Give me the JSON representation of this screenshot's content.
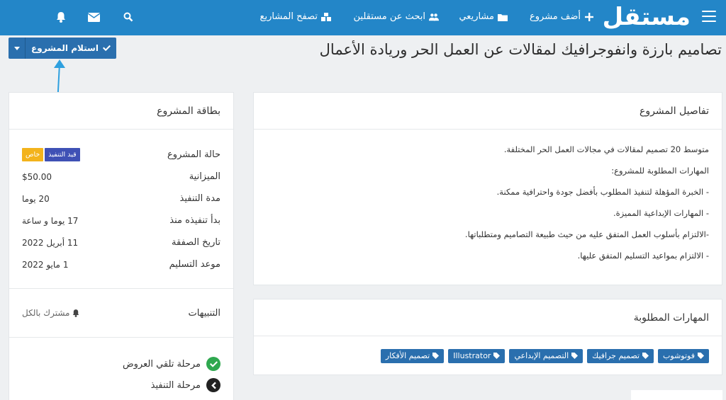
{
  "header": {
    "logo": "مستقل",
    "nav": {
      "add_project": "أضف مشروع",
      "my_projects": "مشاريعي",
      "find_freelancers": "ابحث عن مستقلين",
      "browse_projects": "تصفح المشاريع"
    },
    "icons": [
      "hamburger-icon",
      "plus-icon",
      "folder-icon",
      "users-icon",
      "cubes-icon",
      "search-icon",
      "envelope-icon",
      "bell-icon"
    ]
  },
  "page": {
    "title": "تصاميم بارزة وانفوجرافيك لمقالات عن العمل الحر وريادة الأعمال",
    "receive_button": "استلام المشروع"
  },
  "details": {
    "header": "تفاصيل المشروع",
    "lines": [
      "متوسط 20 تصميم لمقالات في مجالات العمل الحر المختلفة.",
      "المهارات المطلوبة للمشروع:",
      "- الخبرة المؤهلة لتنفيذ المطلوب بأفضل جودة واحترافية ممكنة.",
      "- المهارات الإبداعية المميزة.",
      "-الالتزام بأسلوب العمل المتفق عليه من حيث طبيعة التصاميم ومتطلباتها.",
      "- الالتزام بمواعيد التسليم المتفق عليها."
    ]
  },
  "skills": {
    "header": "المهارات المطلوبة",
    "tags": [
      "فوتوشوب",
      "تصميم جرافيك",
      "التصميم الإبداعي",
      "Illustrator",
      "تصميم الأفكار"
    ]
  },
  "card": {
    "header": "بطاقة المشروع",
    "status_label": "حالة المشروع",
    "status_badge": "قيد التنفيذ",
    "private_badge": "خاص",
    "budget_label": "الميزانية",
    "budget_value": "$50.00",
    "duration_label": "مدة التنفيذ",
    "duration_value": "20 يوما",
    "started_label": "بدأ تنفيذه منذ",
    "started_value": "17 يوما و ساعة",
    "deal_date_label": "تاريخ الصفقة",
    "deal_date_value": "11 أبريل 2022",
    "delivery_label": "موعد التسليم",
    "delivery_value": "1 مايو 2022",
    "notifications_label": "التنبيهات",
    "notifications_value": "مشترك بالكل",
    "stages": [
      "مرحلة تلقي العروض",
      "مرحلة التنفيذ"
    ]
  },
  "colors": {
    "topbar": "#2386c8",
    "button": "#2a6fae",
    "badge_status": "#3f51b5",
    "badge_private": "#f3b31c",
    "stage_done": "#2fa84f"
  }
}
